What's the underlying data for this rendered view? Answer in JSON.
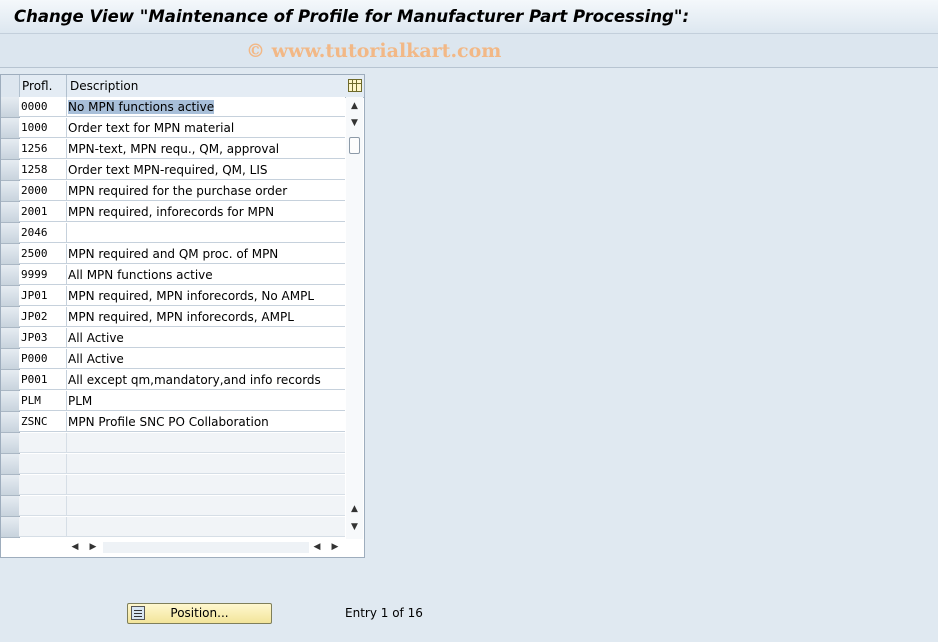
{
  "window": {
    "title": "Change View \"Maintenance of Profile for Manufacturer Part Processing\":",
    "watermark": "© www.tutorialkart.com"
  },
  "table": {
    "columns": [
      "Profl.",
      "Description"
    ],
    "settings_icon": "table-settings-icon",
    "rows": [
      {
        "profl": "0000",
        "desc": "No MPN functions active"
      },
      {
        "profl": "1000",
        "desc": "Order text for MPN material"
      },
      {
        "profl": "1256",
        "desc": "MPN-text, MPN requ., QM, approval"
      },
      {
        "profl": "1258",
        "desc": "Order text MPN-required, QM, LIS"
      },
      {
        "profl": "2000",
        "desc": "MPN required for the purchase order"
      },
      {
        "profl": "2001",
        "desc": "MPN required, inforecords for MPN"
      },
      {
        "profl": "2046",
        "desc": ""
      },
      {
        "profl": "2500",
        "desc": "MPN required and QM proc. of MPN"
      },
      {
        "profl": "9999",
        "desc": "All MPN functions active"
      },
      {
        "profl": "JP01",
        "desc": "MPN required, MPN inforecords, No AMPL"
      },
      {
        "profl": "JP02",
        "desc": "MPN required, MPN inforecords, AMPL"
      },
      {
        "profl": "JP03",
        "desc": "All Active"
      },
      {
        "profl": "P000",
        "desc": "All Active"
      },
      {
        "profl": "P001",
        "desc": "All except qm,mandatory,and info records"
      },
      {
        "profl": "PLM",
        "desc": "PLM"
      },
      {
        "profl": "ZSNC",
        "desc": "MPN Profile SNC PO Collaboration"
      }
    ],
    "empty_rows": 5
  },
  "footer": {
    "position_label": "Position...",
    "entry_text": "Entry 1 of 16"
  }
}
